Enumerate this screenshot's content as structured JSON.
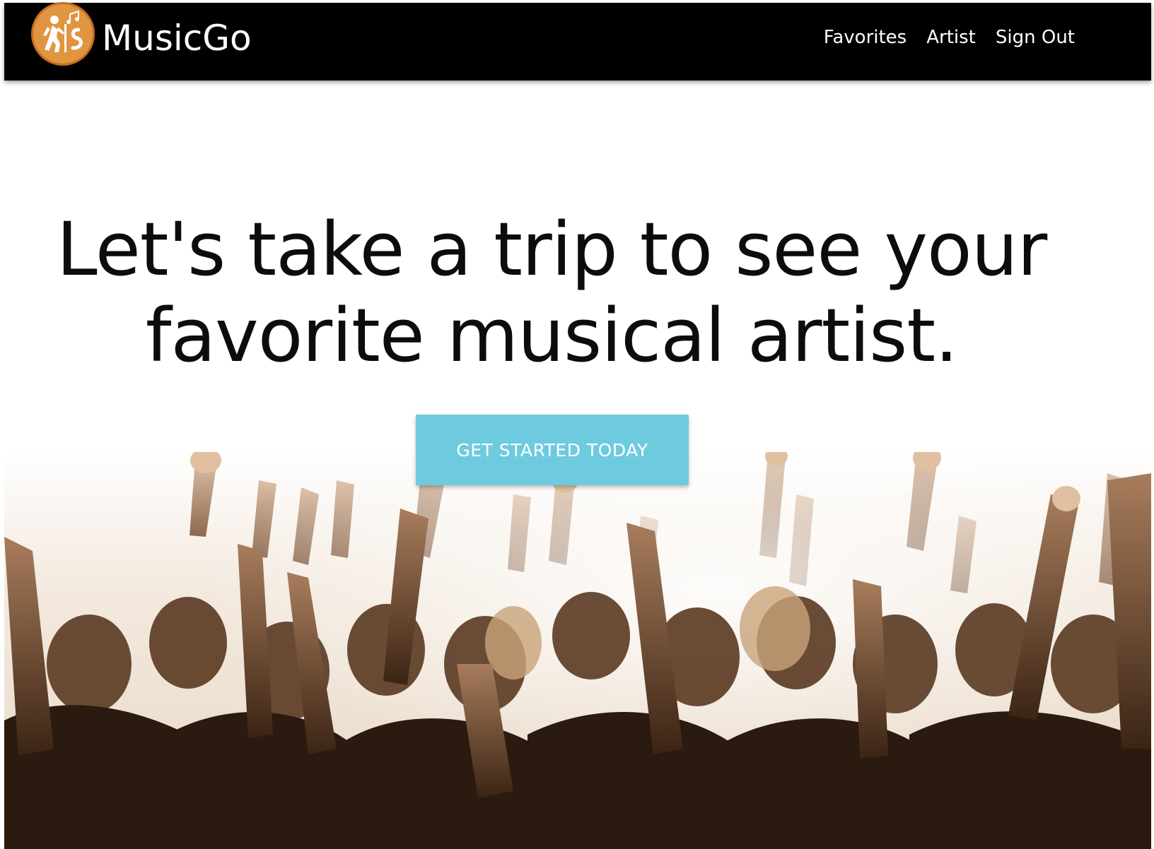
{
  "navbar": {
    "brand_name": "MusicGo",
    "logo_icon": "hiker-music-logo-icon",
    "links": [
      {
        "label": "Favorites"
      },
      {
        "label": "Artist"
      },
      {
        "label": "Sign Out"
      }
    ]
  },
  "hero": {
    "headline_line1": "Let's take a trip to see your",
    "headline_line2": "favorite musical artist.",
    "cta_label": "GET STARTED TODAY"
  },
  "image": {
    "subject": "crowd-with-raised-hands-photo"
  },
  "colors": {
    "navbar_bg": "#000000",
    "logo_bg": "#e09540",
    "cta_bg": "#6ecbdf",
    "headline": "#0c0c0c"
  }
}
